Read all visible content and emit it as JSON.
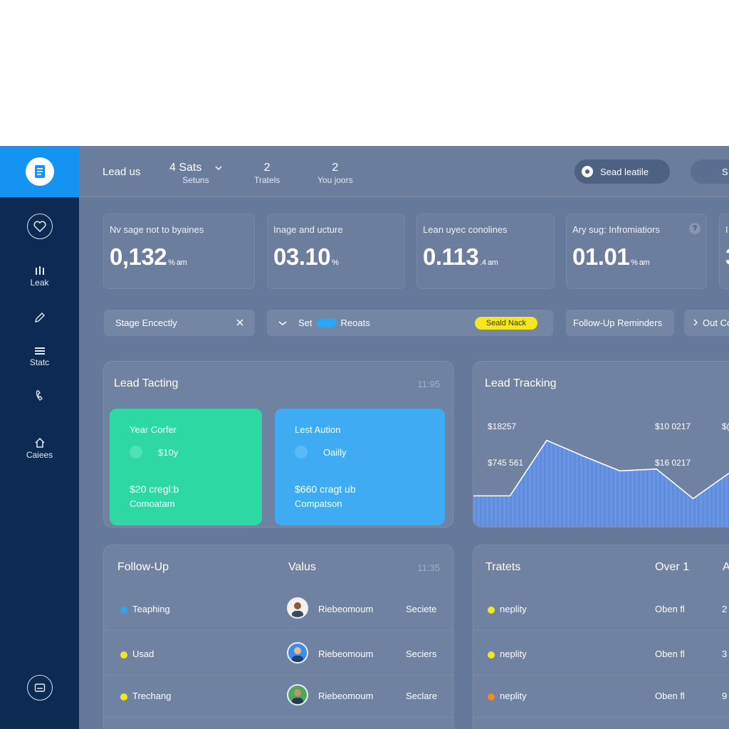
{
  "sidebar": {
    "items": [
      {
        "icon": "heart-icon",
        "label": ""
      },
      {
        "icon": "columns-icon",
        "label": "Leak"
      },
      {
        "icon": "pencil-icon",
        "label": ""
      },
      {
        "icon": "list-icon",
        "label": "Statc"
      },
      {
        "icon": "phone-icon",
        "label": ""
      },
      {
        "icon": "home-icon",
        "label": "Caiees"
      },
      {
        "icon": "inbox-icon",
        "label": ""
      }
    ]
  },
  "topbar": {
    "title": "Lead us",
    "stats": [
      {
        "number": "4 Sats",
        "sub": "Setuns"
      },
      {
        "number": "2",
        "sub": "Tratels"
      },
      {
        "number": "2",
        "sub": "You joors"
      }
    ],
    "button1": "Sead leatile",
    "button2": "S"
  },
  "kpis": [
    {
      "title": "Nv sage not to byaines",
      "value": "0,132",
      "unit": "% am"
    },
    {
      "title": "Inage and ucture",
      "value": "03.10",
      "unit": "%"
    },
    {
      "title": "Lean uyec conolines",
      "value": "0.113",
      "unit": ".4 am"
    },
    {
      "title": "Ary sug: Infromiatiors",
      "value": "01.01",
      "unit": "% am"
    },
    {
      "title": "I",
      "value": "3",
      "unit": ""
    }
  ],
  "filters": {
    "stage": "Stage Encectly",
    "set": "Set",
    "reoats": "Reoats",
    "yellow": "Seald Nack",
    "followup": "Follow-Up Reminders",
    "out": "Out Co"
  },
  "lead_tacting": {
    "title": "Lead Tacting",
    "time": "11:95",
    "card1": {
      "a": "Year Corfer",
      "b": "$10y",
      "d": "$20 cregl:b",
      "e": "Comoatam",
      "color": "#2dd8a3"
    },
    "card2": {
      "a": "Lest Aution",
      "b": "Oailly",
      "d": "$660 cragt ub",
      "e": "Compatson",
      "color": "#3fabf3"
    }
  },
  "lead_tracking": {
    "title": "Lead Tracking",
    "labels": [
      "$18257",
      "$10 0217",
      "$(",
      "$745 561",
      "$16 0217"
    ]
  },
  "chart_data": {
    "type": "area",
    "title": "Lead Tracking",
    "x": [
      0,
      1,
      2,
      3,
      4,
      5,
      6,
      7
    ],
    "values": [
      0.35,
      0.35,
      0.95,
      0.78,
      0.62,
      0.64,
      0.32,
      0.6
    ],
    "fill": "#5f8de0",
    "line": "#ffffff"
  },
  "followup": {
    "headers": {
      "a": "Follow-Up",
      "b": "Valus",
      "time": "11:35"
    },
    "rows": [
      {
        "name": "Teaphing",
        "bullet": "#2ba6f5",
        "person": "Riebeomoum",
        "status": "Seciete"
      },
      {
        "name": "Usad",
        "bullet": "#f5e61d",
        "person": "Riebeomoum",
        "status": "Seciers"
      },
      {
        "name": "Trechang",
        "bullet": "#f5e61d",
        "person": "Riebeomoum",
        "status": "Seclare"
      }
    ]
  },
  "tratets": {
    "headers": {
      "a": "Tratets",
      "b": "Over 1",
      "c": "A"
    },
    "rows": [
      {
        "name": "neplity",
        "bullet": "#f5e61d",
        "value": "Oben fl",
        "extra": "2"
      },
      {
        "name": "neplity",
        "bullet": "#f5e61d",
        "value": "Oben fl",
        "extra": "3"
      },
      {
        "name": "neplity",
        "bullet": "#f58a1d",
        "value": "Oben fl",
        "extra": "9"
      }
    ]
  }
}
